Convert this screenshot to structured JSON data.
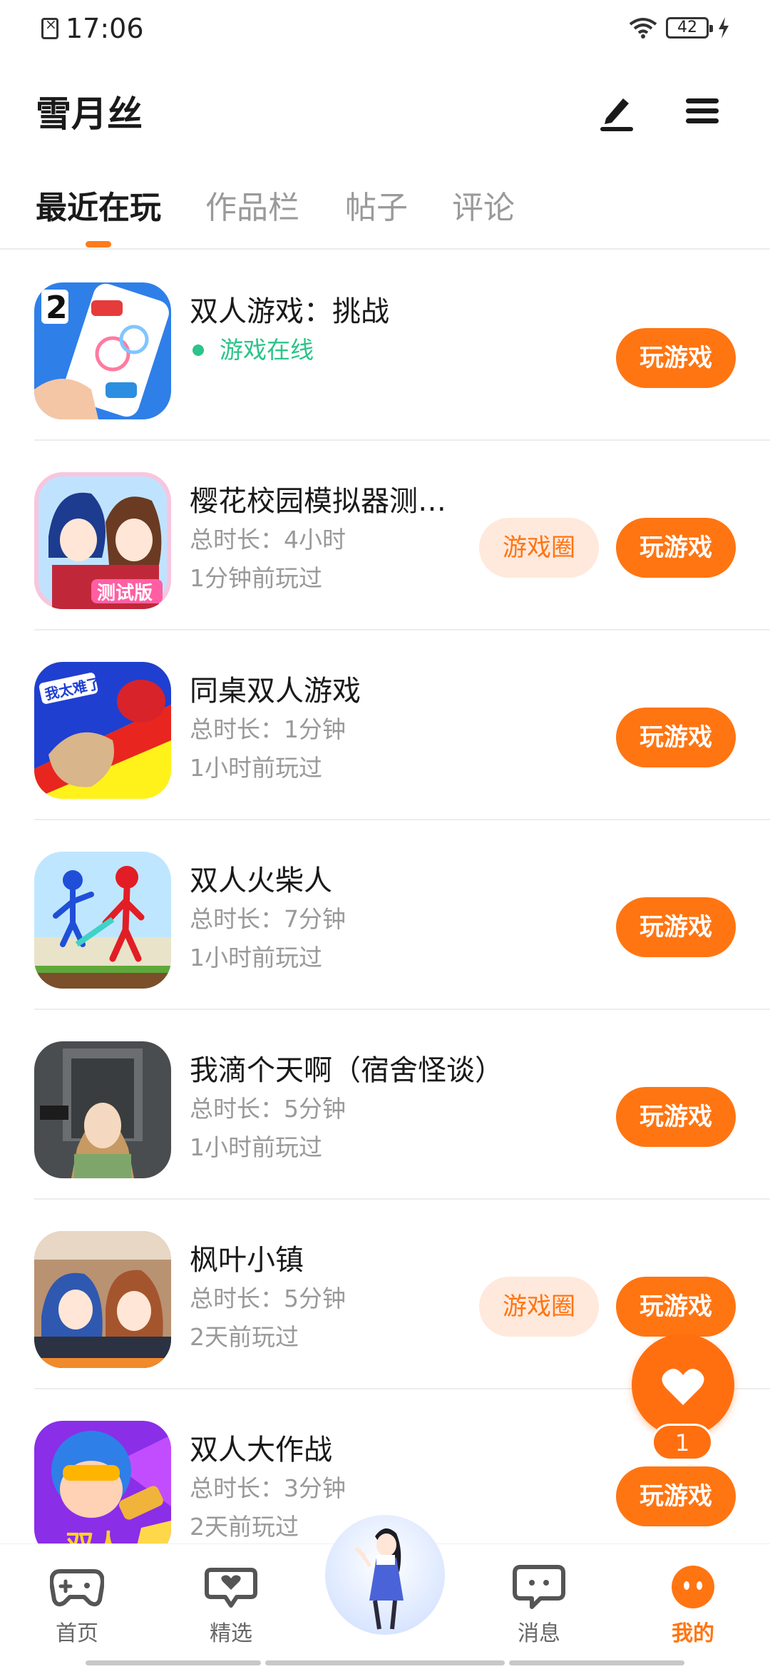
{
  "status_bar": {
    "time": "17:06",
    "battery": "42"
  },
  "header": {
    "title": "雪月丝"
  },
  "tabs": [
    {
      "label": "最近在玩",
      "active": true
    },
    {
      "label": "作品栏",
      "active": false
    },
    {
      "label": "帖子",
      "active": false
    },
    {
      "label": "评论",
      "active": false
    }
  ],
  "games": [
    {
      "title": "双人游戏：挑战",
      "status": "游戏在线",
      "play_label": "玩游戏"
    },
    {
      "title": "樱花校园模拟器测试版",
      "duration": "总时长：4小时",
      "last_played": "1分钟前玩过",
      "circle_label": "游戏圈",
      "play_label": "玩游戏"
    },
    {
      "title": "同桌双人游戏",
      "duration": "总时长：1分钟",
      "last_played": "1小时前玩过",
      "play_label": "玩游戏"
    },
    {
      "title": "双人火柴人",
      "duration": "总时长：7分钟",
      "last_played": "1小时前玩过",
      "play_label": "玩游戏"
    },
    {
      "title": "我滴个天啊（宿舍怪谈）",
      "duration": "总时长：5分钟",
      "last_played": "1小时前玩过",
      "play_label": "玩游戏"
    },
    {
      "title": "枫叶小镇",
      "duration": "总时长：5分钟",
      "last_played": "2天前玩过",
      "circle_label": "游戏圈",
      "play_label": "玩游戏"
    },
    {
      "title": "双人大作战",
      "duration": "总时长：3分钟",
      "last_played": "2天前玩过",
      "play_label": "玩游戏"
    }
  ],
  "floating_like": {
    "count": "1"
  },
  "bottom_nav": [
    {
      "label": "首页",
      "icon": "gamepad-icon"
    },
    {
      "label": "精选",
      "icon": "heart-chat-icon"
    },
    {
      "label": "",
      "icon": "avatar-character"
    },
    {
      "label": "消息",
      "icon": "message-icon"
    },
    {
      "label": "我的",
      "icon": "profile-face-icon",
      "active": true
    }
  ],
  "colors": {
    "accent": "#ff7512",
    "online": "#2bc48a",
    "circle_bg": "#ffe9dc"
  }
}
